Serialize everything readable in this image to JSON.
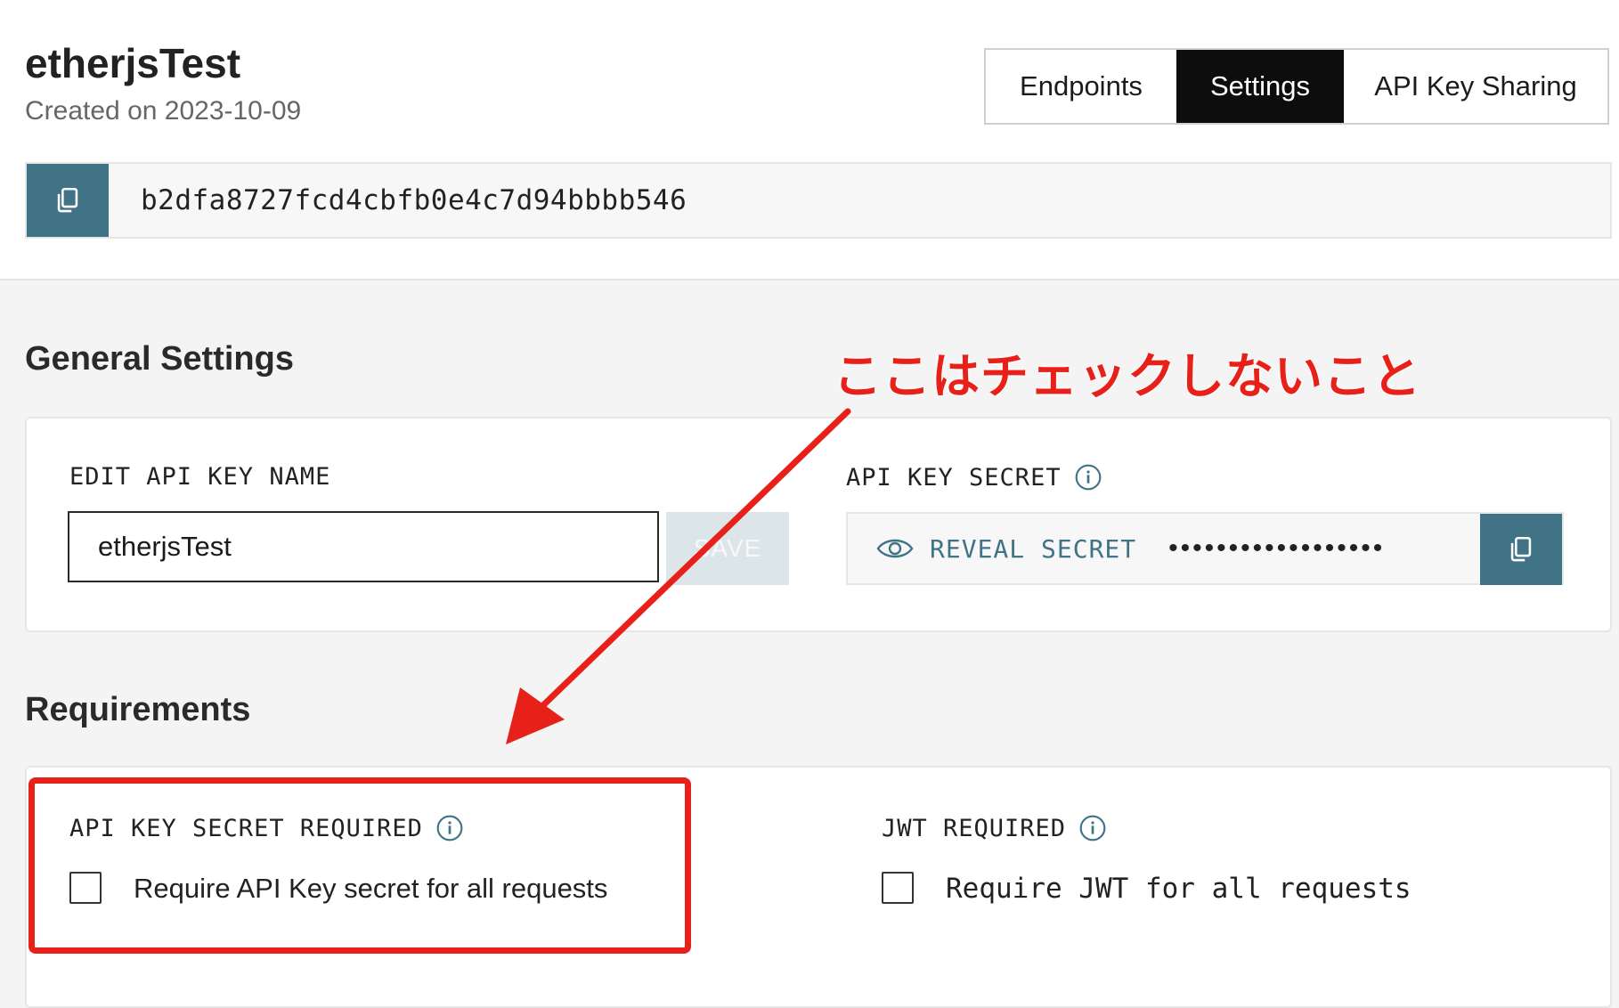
{
  "header": {
    "title": "etherjsTest",
    "subtitle": "Created on 2023-10-09"
  },
  "tabs": [
    {
      "label": "Endpoints",
      "active": false
    },
    {
      "label": "Settings",
      "active": true
    },
    {
      "label": "API Key Sharing",
      "active": false
    }
  ],
  "api_key": {
    "value": "b2dfa8727fcd4cbfb0e4c7d94bbbb546",
    "copy_icon": "copy-icon"
  },
  "general_settings": {
    "heading": "General Settings",
    "edit_name": {
      "label": "EDIT API KEY NAME",
      "value": "etherjsTest",
      "save_label": "SAVE"
    },
    "secret": {
      "label": "API KEY SECRET",
      "reveal_label": "REVEAL SECRET",
      "masked": "••••••••••••••••••"
    }
  },
  "requirements": {
    "heading": "Requirements",
    "secret_required": {
      "label": "API KEY SECRET REQUIRED",
      "checkbox_label": "Require API Key secret for all requests",
      "checked": false
    },
    "jwt_required": {
      "label": "JWT REQUIRED",
      "checkbox_label": "Require JWT for all requests",
      "checked": false
    }
  },
  "annotation": {
    "text": "ここはチェックしないこと"
  },
  "colors": {
    "accent": "#3f7385",
    "annotation": "#e8201a",
    "active_tab": "#0d0d0d"
  }
}
